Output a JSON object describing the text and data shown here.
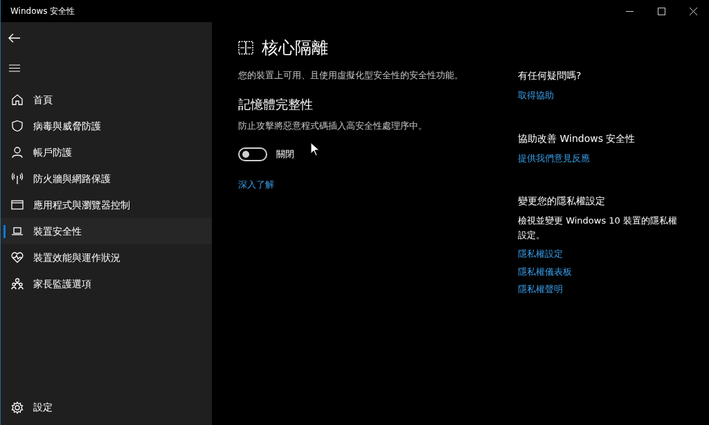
{
  "window": {
    "title": "Windows 安全性"
  },
  "sidebar": {
    "items": [
      {
        "label": "首頁",
        "selected": false
      },
      {
        "label": "病毒與威脅防護",
        "selected": false
      },
      {
        "label": "帳戶防護",
        "selected": false
      },
      {
        "label": "防火牆與網路保護",
        "selected": false
      },
      {
        "label": "應用程式與瀏覽器控制",
        "selected": false
      },
      {
        "label": "裝置安全性",
        "selected": true
      },
      {
        "label": "裝置效能與運作狀況",
        "selected": false
      },
      {
        "label": "家長監護選項",
        "selected": false
      }
    ],
    "settings": "設定"
  },
  "main": {
    "title": "核心隔離",
    "description": "您的裝置上可用、且使用虛擬化型安全性的安全性功能。",
    "section": {
      "heading": "記憶體完整性",
      "description": "防止攻擊將惡意程式碼插入高安全性處理序中。",
      "toggle": {
        "on": false,
        "label": "關閉"
      }
    },
    "link": "深入了解"
  },
  "aside": [
    {
      "heading": "有任何疑問嗎?",
      "links": [
        "取得協助"
      ]
    },
    {
      "heading": "協助改善 Windows 安全性",
      "links": [
        "提供我們意見反應"
      ]
    },
    {
      "heading": "變更您的隱私權設定",
      "text": "檢視並變更 Windows 10 裝置的隱私權設定。",
      "links": [
        "隱私權設定",
        "隱私權儀表板",
        "隱私權聲明"
      ]
    }
  ]
}
